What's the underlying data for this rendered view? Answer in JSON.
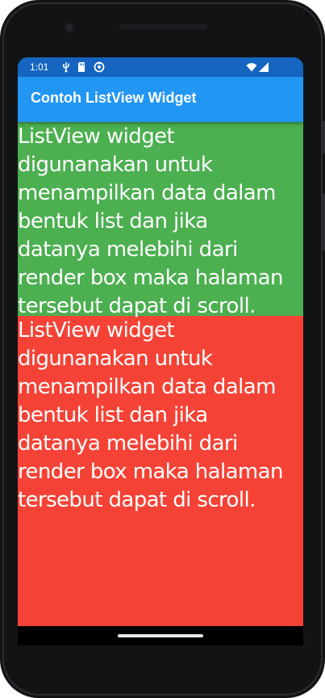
{
  "status_bar": {
    "time": "1:01",
    "icons": [
      "usb-debug-icon",
      "sd-card-icon",
      "sync-icon",
      "wifi-icon",
      "signal-icon"
    ]
  },
  "app_bar": {
    "title": "Contoh ListView Widget"
  },
  "list": {
    "items": [
      {
        "text": "ListView widget\ndigunanakan untuk\nmenampilkan data dalam\nbentuk list dan jika\ndatanya melebihi dari\nrender box maka halaman\ntersebut dapat di scroll.",
        "color": "#4caf50"
      },
      {
        "text": "ListView widget\ndigunanakan untuk\nmenampilkan data dalam\nbentuk list dan jika\ndatanya melebihi dari\nrender box maka halaman\ntersebut dapat di scroll.",
        "color": "#f44336"
      }
    ]
  },
  "colors": {
    "app_bar": "#2196f3",
    "status_bar": "#1565c0",
    "device_frame": "#121315"
  }
}
